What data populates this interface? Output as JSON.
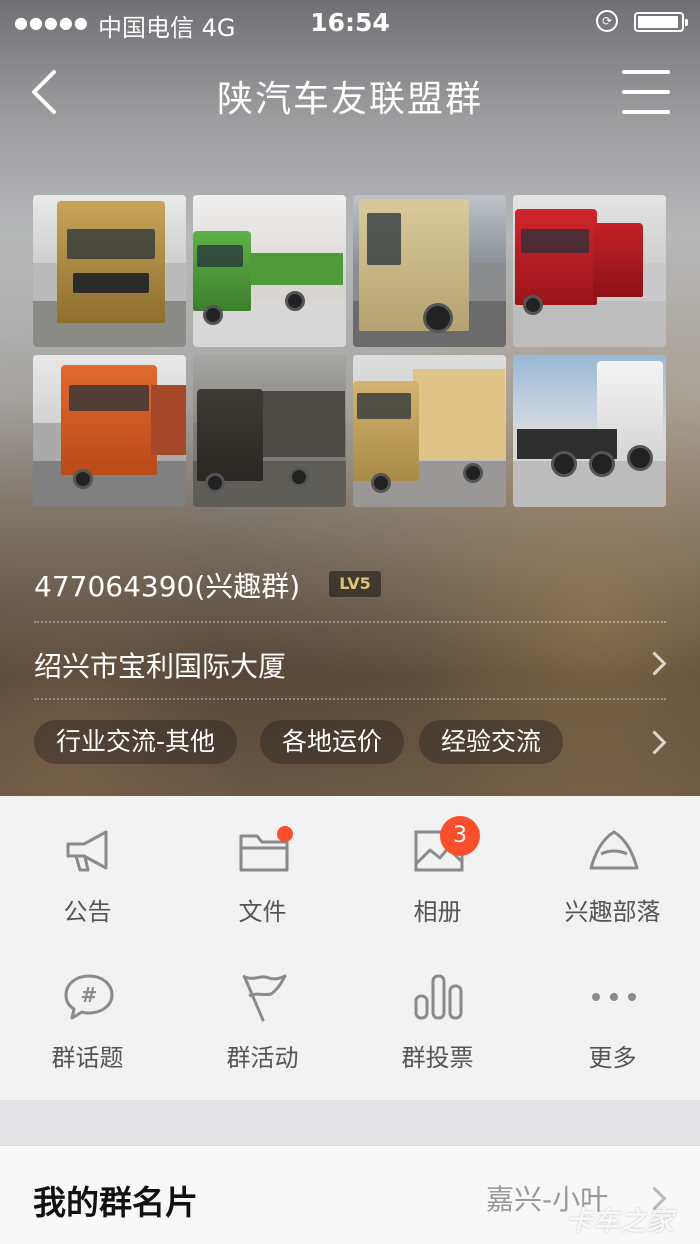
{
  "status_bar": {
    "signal": "●●●●●",
    "carrier": "中国电信  4G",
    "time": "16:54"
  },
  "nav": {
    "title": "陕汽车友联盟群"
  },
  "group": {
    "id_text": "477064390(兴趣群)",
    "level": "LV5",
    "address": "绍兴市宝利国际大厦",
    "tags": [
      "行业交流-其他",
      "各地运价",
      "经验交流"
    ]
  },
  "features": [
    {
      "label": "公告",
      "icon": "megaphone-icon"
    },
    {
      "label": "文件",
      "icon": "folder-icon"
    },
    {
      "label": "相册",
      "icon": "album-icon",
      "badge": "3"
    },
    {
      "label": "兴趣部落",
      "icon": "tent-icon"
    },
    {
      "label": "群话题",
      "icon": "topic-icon"
    },
    {
      "label": "群活动",
      "icon": "flag-icon"
    },
    {
      "label": "群投票",
      "icon": "vote-icon"
    },
    {
      "label": "更多",
      "icon": "more-icon"
    }
  ],
  "my_card": {
    "title": "我的群名片",
    "value": "嘉兴-小叶"
  },
  "watermark": "卡车之家",
  "colors": {
    "badge": "#fb4f2b",
    "level_text": "#e2c370"
  }
}
